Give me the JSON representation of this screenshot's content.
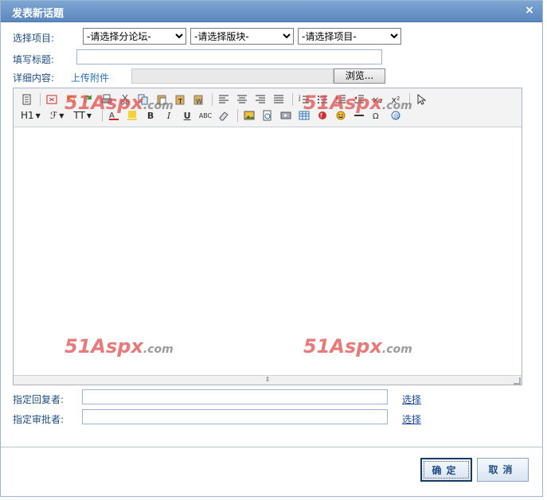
{
  "dialog": {
    "title": "发表新话题",
    "close_glyph": "×"
  },
  "select_project": {
    "label": "选择项目:",
    "forum": "-请选择分论坛-",
    "board": "-请选择版块-",
    "project": "-请选择项目-"
  },
  "title_field": {
    "label": "填写标题:",
    "value": ""
  },
  "content": {
    "label": "详细内容:",
    "upload_link": "上传附件",
    "browse_label": "浏览..."
  },
  "editor": {
    "heading_btn": "H1",
    "font_btn": "ℱ",
    "size_btn": "TT",
    "bold": "B",
    "italic": "I",
    "underline": "U",
    "spell": "ABC",
    "superscript": "x²",
    "subscript": "×₂",
    "watermark_brand": "51Aspx",
    "watermark_tld": ".com"
  },
  "reply_to": {
    "label": "指定回复者:",
    "value": "",
    "choose": "选择"
  },
  "approver": {
    "label": "指定审批者:",
    "value": "",
    "choose": "选择"
  },
  "buttons": {
    "ok": "确定",
    "cancel": "取消"
  }
}
